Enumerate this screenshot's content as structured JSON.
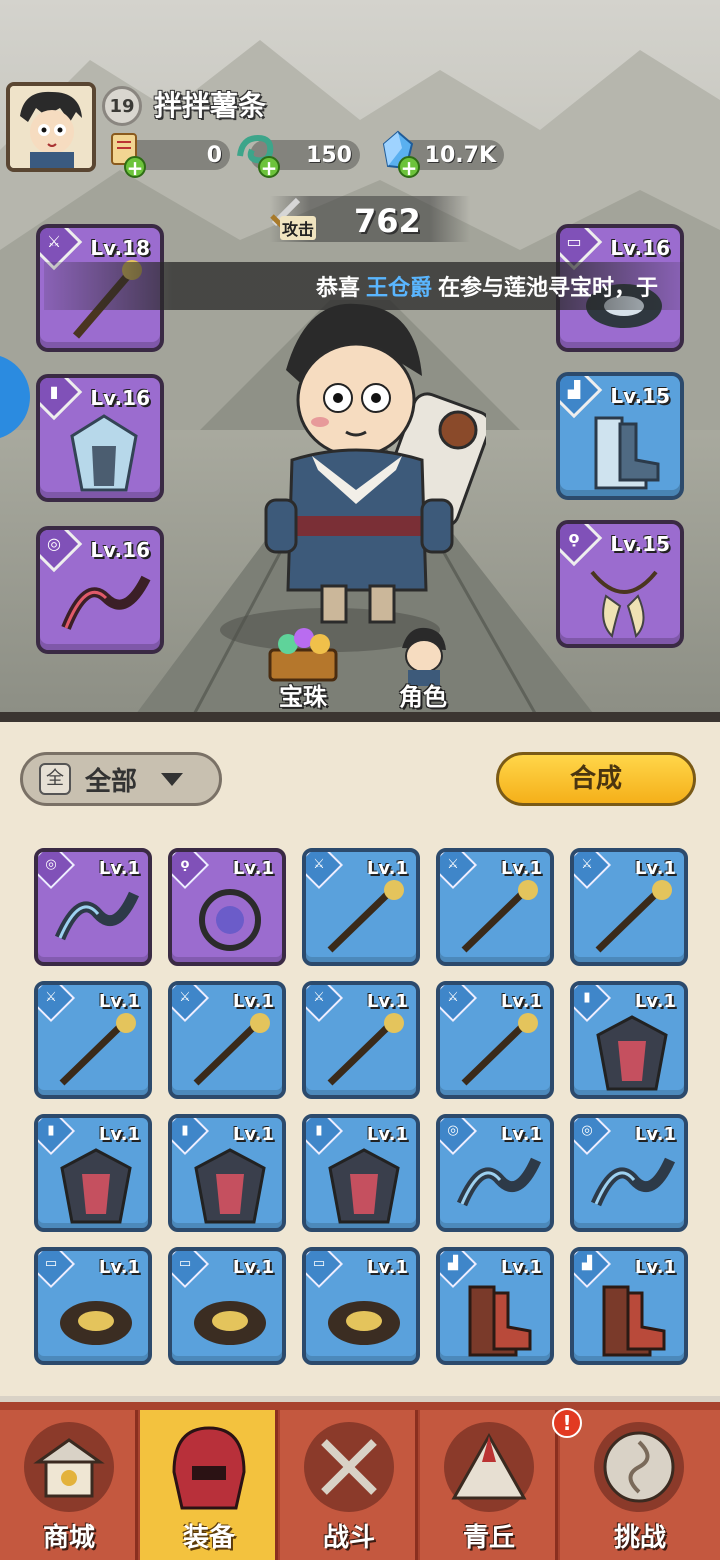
{
  "player": {
    "name": "拌拌薯条",
    "level": "19"
  },
  "resources": [
    {
      "name": "scroll",
      "value": "0"
    },
    {
      "name": "jade",
      "value": "150"
    },
    {
      "name": "crystal",
      "value": "10.7K"
    }
  ],
  "attack": {
    "label": "攻击",
    "value": "762"
  },
  "ticker": {
    "prefix": "恭喜",
    "highlight": "王仓爵",
    "suffix": "在参与莲池寻宝时，于"
  },
  "equipped": {
    "left": [
      {
        "slot": "weapon",
        "level": "Lv.18",
        "rarity": "purple"
      },
      {
        "slot": "armor",
        "level": "Lv.16",
        "rarity": "purple"
      },
      {
        "slot": "bracer",
        "level": "Lv.16",
        "rarity": "purple"
      }
    ],
    "right": [
      {
        "slot": "belt",
        "level": "Lv.16",
        "rarity": "purple"
      },
      {
        "slot": "boots",
        "level": "Lv.15",
        "rarity": "blue"
      },
      {
        "slot": "necklace",
        "level": "Lv.15",
        "rarity": "purple"
      }
    ]
  },
  "scene_buttons": {
    "gems": "宝珠",
    "character": "角色"
  },
  "filter": {
    "tag": "全",
    "label": "全部"
  },
  "merge_button": "合成",
  "inventory": [
    {
      "level": "Lv.1",
      "rarity": "purple",
      "slot": "bracer"
    },
    {
      "level": "Lv.1",
      "rarity": "purple",
      "slot": "necklace"
    },
    {
      "level": "Lv.1",
      "rarity": "blue",
      "slot": "weapon"
    },
    {
      "level": "Lv.1",
      "rarity": "blue",
      "slot": "weapon"
    },
    {
      "level": "Lv.1",
      "rarity": "blue",
      "slot": "weapon"
    },
    {
      "level": "Lv.1",
      "rarity": "blue",
      "slot": "weapon"
    },
    {
      "level": "Lv.1",
      "rarity": "blue",
      "slot": "weapon"
    },
    {
      "level": "Lv.1",
      "rarity": "blue",
      "slot": "weapon"
    },
    {
      "level": "Lv.1",
      "rarity": "blue",
      "slot": "weapon"
    },
    {
      "level": "Lv.1",
      "rarity": "blue",
      "slot": "armor"
    },
    {
      "level": "Lv.1",
      "rarity": "blue",
      "slot": "armor"
    },
    {
      "level": "Lv.1",
      "rarity": "blue",
      "slot": "armor"
    },
    {
      "level": "Lv.1",
      "rarity": "blue",
      "slot": "armor"
    },
    {
      "level": "Lv.1",
      "rarity": "blue",
      "slot": "bracer"
    },
    {
      "level": "Lv.1",
      "rarity": "blue",
      "slot": "bracer"
    },
    {
      "level": "Lv.1",
      "rarity": "blue",
      "slot": "belt"
    },
    {
      "level": "Lv.1",
      "rarity": "blue",
      "slot": "belt"
    },
    {
      "level": "Lv.1",
      "rarity": "blue",
      "slot": "belt"
    },
    {
      "level": "Lv.1",
      "rarity": "blue",
      "slot": "boots"
    },
    {
      "level": "Lv.1",
      "rarity": "blue",
      "slot": "boots"
    }
  ],
  "nav": [
    {
      "label": "商城",
      "icon": "shop-icon"
    },
    {
      "label": "装备",
      "icon": "helmet-icon",
      "active": true
    },
    {
      "label": "战斗",
      "icon": "crossed-swords-icon"
    },
    {
      "label": "青丘",
      "icon": "mountain-icon"
    },
    {
      "label": "挑战",
      "icon": "challenge-orb-icon"
    }
  ],
  "nav_alert": "!",
  "colors": {
    "purple": "#9b6ccf",
    "blue": "#5aa1dc",
    "gold": "#f5b01a",
    "nav": "#c4583f",
    "nav_active": "#f3c23e"
  }
}
